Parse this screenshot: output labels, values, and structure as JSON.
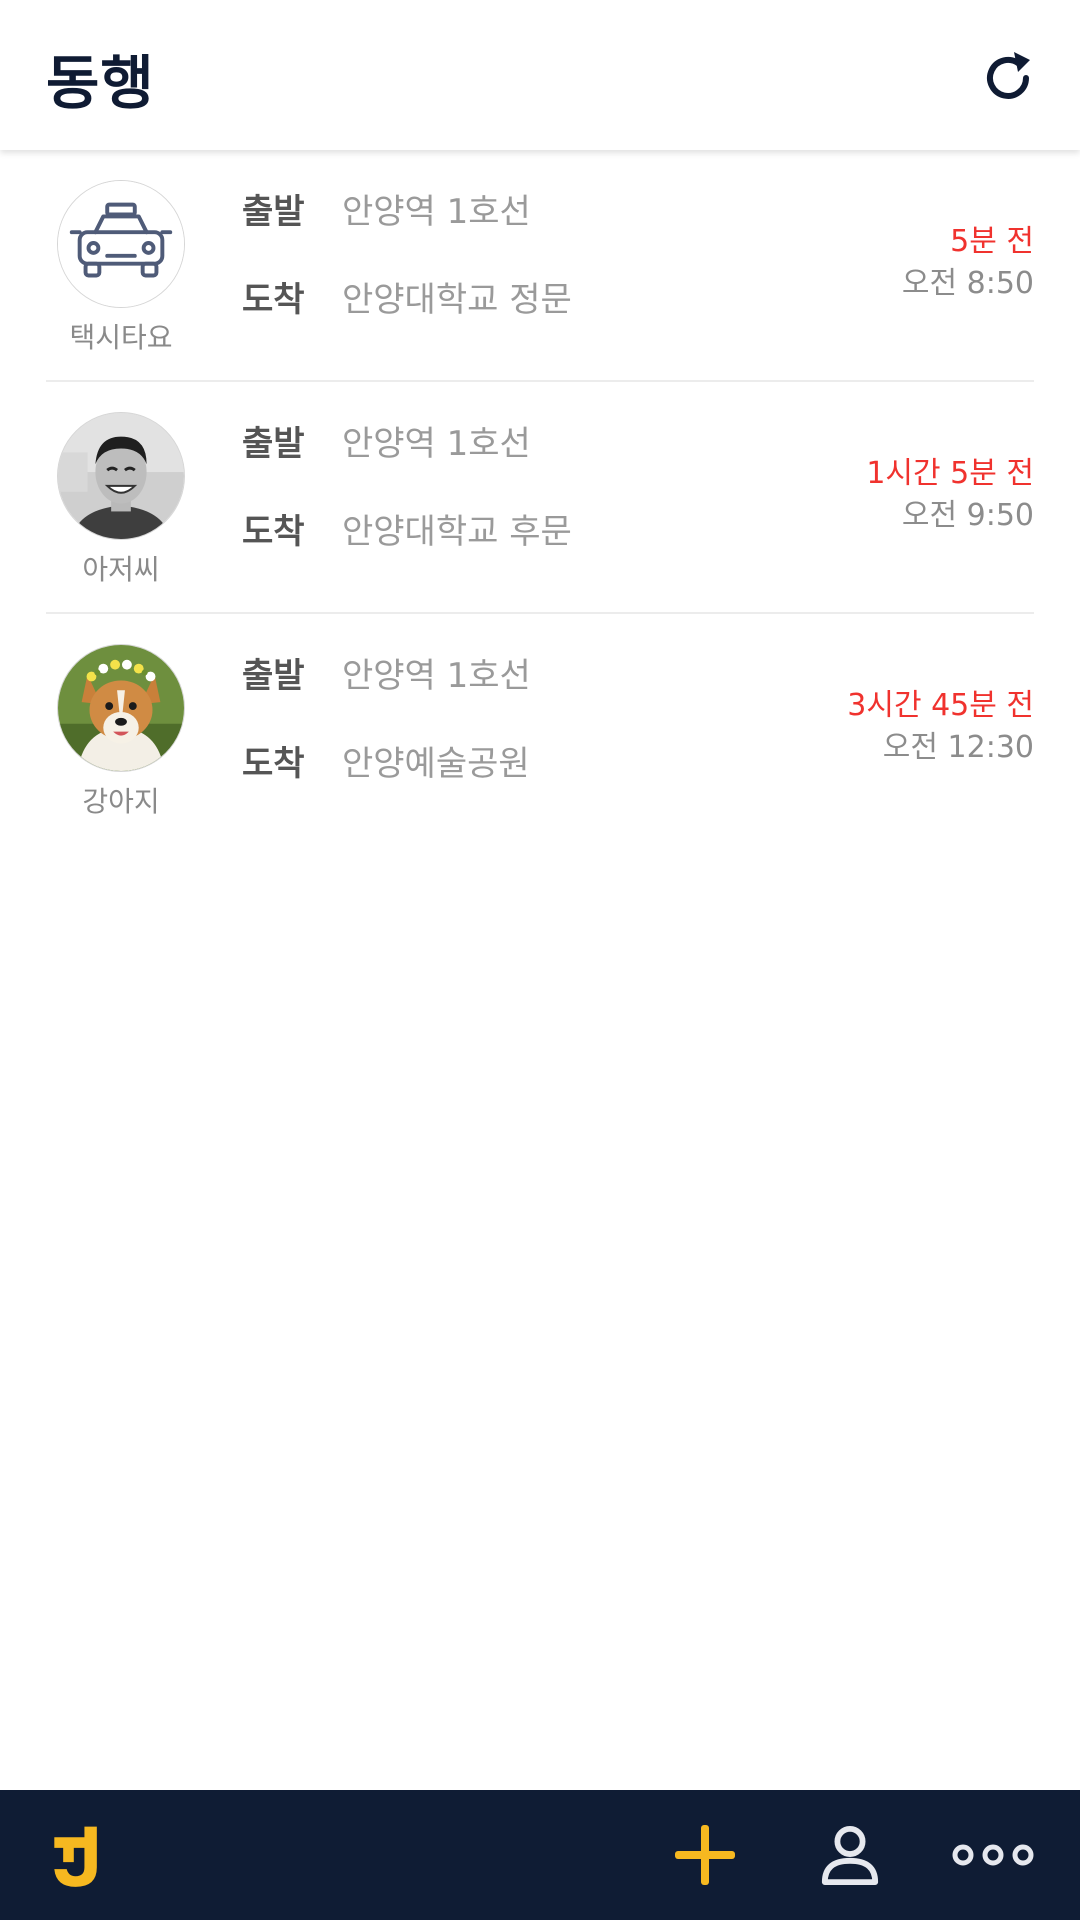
{
  "header": {
    "title": "동행",
    "refresh_icon": "refresh-icon"
  },
  "rides": [
    {
      "avatar_icon": "taxi-icon",
      "name": "택시타요",
      "departure_label": "출발",
      "departure": "안양역  1호선",
      "arrival_label": "도착",
      "arrival": "안양대학교 정문",
      "ago": "5분 전",
      "time": "오전 8:50"
    },
    {
      "avatar_icon": "man-photo",
      "name": "아저씨",
      "departure_label": "출발",
      "departure": "안양역  1호선",
      "arrival_label": "도착",
      "arrival": "안양대학교 후문",
      "ago": "1시간 5분 전",
      "time": "오전 9:50"
    },
    {
      "avatar_icon": "dog-photo",
      "name": "강아지",
      "departure_label": "출발",
      "departure": "안양역 1호선",
      "arrival_label": "도착",
      "arrival": "안양예술공원",
      "ago": "3시간 45분 전",
      "time": "오전 12:30"
    }
  ],
  "bottom_nav": {
    "items": [
      "logo-icon",
      "add-icon",
      "profile-icon",
      "more-icon"
    ]
  },
  "colors": {
    "navy": "#0f1c34",
    "accent_yellow": "#f6b820",
    "alert_red": "#f0322e"
  }
}
